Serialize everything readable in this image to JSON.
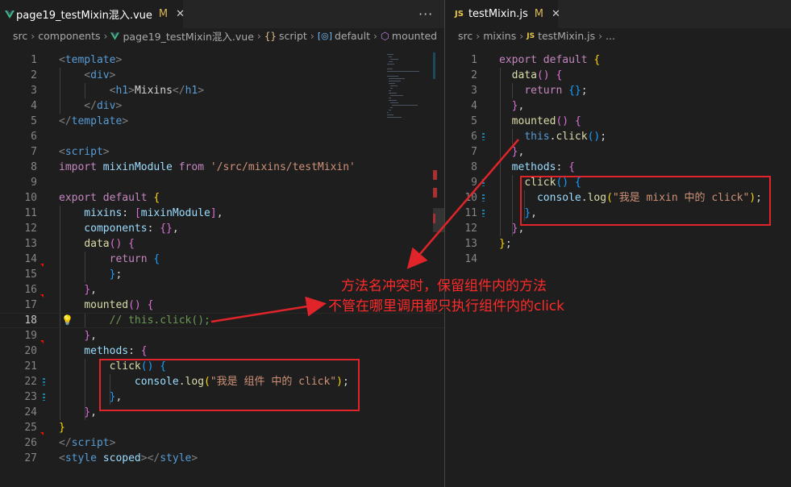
{
  "left_pane": {
    "tab": {
      "filename": "page19_testMixin混入.vue",
      "modified": "M",
      "close": "✕"
    },
    "more": "···",
    "breadcrumb": [
      "src",
      "components",
      "page19_testMixin混入.vue",
      "script",
      "default",
      "mounted"
    ],
    "lines": [
      {
        "n": "1",
        "parts": [
          [
            "<",
            "t-punct"
          ],
          [
            "template",
            "t-tag"
          ],
          [
            ">",
            "t-punct"
          ]
        ]
      },
      {
        "n": "2",
        "parts": [
          [
            "    <",
            "t-punct"
          ],
          [
            "div",
            "t-tag"
          ],
          [
            ">",
            "t-punct"
          ]
        ]
      },
      {
        "n": "3",
        "parts": [
          [
            "        <",
            "t-punct"
          ],
          [
            "h1",
            "t-tag"
          ],
          [
            ">",
            "t-punct"
          ],
          [
            "Mixins",
            "t-text"
          ],
          [
            "</",
            "t-punct"
          ],
          [
            "h1",
            "t-tag"
          ],
          [
            ">",
            "t-punct"
          ]
        ]
      },
      {
        "n": "4",
        "parts": [
          [
            "    </",
            "t-punct"
          ],
          [
            "div",
            "t-tag"
          ],
          [
            ">",
            "t-punct"
          ]
        ]
      },
      {
        "n": "5",
        "parts": [
          [
            "</",
            "t-punct"
          ],
          [
            "template",
            "t-tag"
          ],
          [
            ">",
            "t-punct"
          ]
        ]
      },
      {
        "n": "6",
        "parts": []
      },
      {
        "n": "7",
        "parts": [
          [
            "<",
            "t-punct"
          ],
          [
            "script",
            "t-tag"
          ],
          [
            ">",
            "t-punct"
          ]
        ]
      },
      {
        "n": "8",
        "parts": [
          [
            "import",
            "t-kw2"
          ],
          [
            " mixinModule ",
            "t-var"
          ],
          [
            "from",
            "t-kw2"
          ],
          [
            " ",
            "t-text"
          ],
          [
            "'/src/mixins/testMixin'",
            "t-str"
          ]
        ]
      },
      {
        "n": "9",
        "parts": []
      },
      {
        "n": "10",
        "parts": [
          [
            "export",
            "t-kw2"
          ],
          [
            " ",
            "t-text"
          ],
          [
            "default",
            "t-kw2"
          ],
          [
            " ",
            "t-text"
          ],
          [
            "{",
            "t-b1"
          ]
        ]
      },
      {
        "n": "11",
        "parts": [
          [
            "    mixins",
            "t-var"
          ],
          [
            ": ",
            "t-text"
          ],
          [
            "[",
            "t-b2"
          ],
          [
            "mixinModule",
            "t-var"
          ],
          [
            "]",
            "t-b2"
          ],
          [
            ",",
            "t-text"
          ]
        ]
      },
      {
        "n": "12",
        "parts": [
          [
            "    components",
            "t-var"
          ],
          [
            ": ",
            "t-text"
          ],
          [
            "{}",
            "t-b2"
          ],
          [
            ",",
            "t-text"
          ]
        ]
      },
      {
        "n": "13",
        "parts": [
          [
            "    ",
            "t-text"
          ],
          [
            "data",
            "t-fn"
          ],
          [
            "()",
            "t-b2"
          ],
          [
            " ",
            "t-text"
          ],
          [
            "{",
            "t-b2"
          ]
        ]
      },
      {
        "n": "14",
        "parts": [
          [
            "        ",
            "t-text"
          ],
          [
            "return",
            "t-kw2"
          ],
          [
            " ",
            "t-text"
          ],
          [
            "{",
            "t-b3"
          ]
        ]
      },
      {
        "n": "15",
        "parts": [
          [
            "        ",
            "t-text"
          ],
          [
            "}",
            "t-b3"
          ],
          [
            ";",
            "t-text"
          ]
        ]
      },
      {
        "n": "16",
        "parts": [
          [
            "    ",
            "t-text"
          ],
          [
            "}",
            "t-b2"
          ],
          [
            ",",
            "t-text"
          ]
        ]
      },
      {
        "n": "17",
        "parts": [
          [
            "    ",
            "t-text"
          ],
          [
            "mounted",
            "t-fn"
          ],
          [
            "()",
            "t-b2"
          ],
          [
            " ",
            "t-text"
          ],
          [
            "{",
            "t-b2"
          ]
        ]
      },
      {
        "n": "18",
        "parts": [
          [
            "        ",
            "t-text"
          ],
          [
            "// this.click();",
            "t-cmt"
          ]
        ]
      },
      {
        "n": "19",
        "parts": [
          [
            "    ",
            "t-text"
          ],
          [
            "}",
            "t-b2"
          ],
          [
            ",",
            "t-text"
          ]
        ]
      },
      {
        "n": "20",
        "parts": [
          [
            "    methods",
            "t-var"
          ],
          [
            ": ",
            "t-text"
          ],
          [
            "{",
            "t-b2"
          ]
        ]
      },
      {
        "n": "21",
        "parts": [
          [
            "        ",
            "t-text"
          ],
          [
            "click",
            "t-fn"
          ],
          [
            "()",
            "t-b3"
          ],
          [
            " ",
            "t-text"
          ],
          [
            "{",
            "t-b3"
          ]
        ]
      },
      {
        "n": "22",
        "parts": [
          [
            "            ",
            "t-text"
          ],
          [
            "console",
            "t-var"
          ],
          [
            ".",
            "t-text"
          ],
          [
            "log",
            "t-fn"
          ],
          [
            "(",
            "t-b1"
          ],
          [
            "\"我是 组件 中的 click\"",
            "t-str"
          ],
          [
            ")",
            "t-b1"
          ],
          [
            ";",
            "t-text"
          ]
        ]
      },
      {
        "n": "23",
        "parts": [
          [
            "        ",
            "t-text"
          ],
          [
            "}",
            "t-b3"
          ],
          [
            ",",
            "t-text"
          ]
        ]
      },
      {
        "n": "24",
        "parts": [
          [
            "    ",
            "t-text"
          ],
          [
            "}",
            "t-b2"
          ],
          [
            ",",
            "t-text"
          ]
        ]
      },
      {
        "n": "25",
        "parts": [
          [
            "}",
            "t-b1"
          ]
        ]
      },
      {
        "n": "26",
        "parts": [
          [
            "</",
            "t-punct"
          ],
          [
            "script",
            "t-tag"
          ],
          [
            ">",
            "t-punct"
          ]
        ]
      },
      {
        "n": "27",
        "parts": [
          [
            "<",
            "t-punct"
          ],
          [
            "style",
            "t-tag"
          ],
          [
            " ",
            "t-text"
          ],
          [
            "scoped",
            "t-var"
          ],
          [
            "></",
            "t-punct"
          ],
          [
            "style",
            "t-tag"
          ],
          [
            ">",
            "t-punct"
          ]
        ]
      }
    ]
  },
  "right_pane": {
    "tab": {
      "icon": "JS",
      "filename": "testMixin.js",
      "modified": "M",
      "close": "✕"
    },
    "breadcrumb": [
      "src",
      "mixins",
      "testMixin.js",
      "..."
    ],
    "lines": [
      {
        "n": "1",
        "parts": [
          [
            "export",
            "t-kw2"
          ],
          [
            " ",
            "t-text"
          ],
          [
            "default",
            "t-kw2"
          ],
          [
            " ",
            "t-text"
          ],
          [
            "{",
            "t-b1"
          ]
        ]
      },
      {
        "n": "2",
        "parts": [
          [
            "  ",
            "t-text"
          ],
          [
            "data",
            "t-fn"
          ],
          [
            "()",
            "t-b2"
          ],
          [
            " ",
            "t-text"
          ],
          [
            "{",
            "t-b2"
          ]
        ]
      },
      {
        "n": "3",
        "parts": [
          [
            "    ",
            "t-text"
          ],
          [
            "return",
            "t-kw2"
          ],
          [
            " ",
            "t-text"
          ],
          [
            "{}",
            "t-b3"
          ],
          [
            ";",
            "t-text"
          ]
        ]
      },
      {
        "n": "4",
        "parts": [
          [
            "  ",
            "t-text"
          ],
          [
            "}",
            "t-b2"
          ],
          [
            ",",
            "t-text"
          ]
        ]
      },
      {
        "n": "5",
        "parts": [
          [
            "  ",
            "t-text"
          ],
          [
            "mounted",
            "t-fn"
          ],
          [
            "()",
            "t-b2"
          ],
          [
            " ",
            "t-text"
          ],
          [
            "{",
            "t-b2"
          ]
        ]
      },
      {
        "n": "6",
        "parts": [
          [
            "    ",
            "t-text"
          ],
          [
            "this",
            "t-kw"
          ],
          [
            ".",
            "t-text"
          ],
          [
            "click",
            "t-fn"
          ],
          [
            "()",
            "t-b3"
          ],
          [
            ";",
            "t-text"
          ]
        ]
      },
      {
        "n": "7",
        "parts": [
          [
            "  ",
            "t-text"
          ],
          [
            "}",
            "t-b2"
          ],
          [
            ",",
            "t-text"
          ]
        ]
      },
      {
        "n": "8",
        "parts": [
          [
            "  methods",
            "t-var"
          ],
          [
            ": ",
            "t-text"
          ],
          [
            "{",
            "t-b2"
          ]
        ]
      },
      {
        "n": "9",
        "parts": [
          [
            "    ",
            "t-text"
          ],
          [
            "click",
            "t-fn"
          ],
          [
            "()",
            "t-b3"
          ],
          [
            " ",
            "t-text"
          ],
          [
            "{",
            "t-b3"
          ]
        ]
      },
      {
        "n": "10",
        "parts": [
          [
            "      ",
            "t-text"
          ],
          [
            "console",
            "t-var"
          ],
          [
            ".",
            "t-text"
          ],
          [
            "log",
            "t-fn"
          ],
          [
            "(",
            "t-b1"
          ],
          [
            "\"我是 mixin 中的 click\"",
            "t-str"
          ],
          [
            ")",
            "t-b1"
          ],
          [
            ";",
            "t-text"
          ]
        ]
      },
      {
        "n": "11",
        "parts": [
          [
            "    ",
            "t-text"
          ],
          [
            "}",
            "t-b3"
          ],
          [
            ",",
            "t-text"
          ]
        ]
      },
      {
        "n": "12",
        "parts": [
          [
            "  ",
            "t-text"
          ],
          [
            "}",
            "t-b2"
          ],
          [
            ",",
            "t-text"
          ]
        ]
      },
      {
        "n": "13",
        "parts": [
          [
            "}",
            "t-b1"
          ],
          [
            ";",
            "t-text"
          ]
        ]
      },
      {
        "n": "14",
        "parts": []
      }
    ]
  },
  "annotation": {
    "line1": "方法名冲突时，保留组件内的方法",
    "line2": "不管在哪里调用都只执行组件内的click"
  },
  "colors": {
    "annotation": "#ff2a2a",
    "vue_icon": "#41b883",
    "js_icon": "#e8c84a",
    "modified": "#d7b55a"
  }
}
